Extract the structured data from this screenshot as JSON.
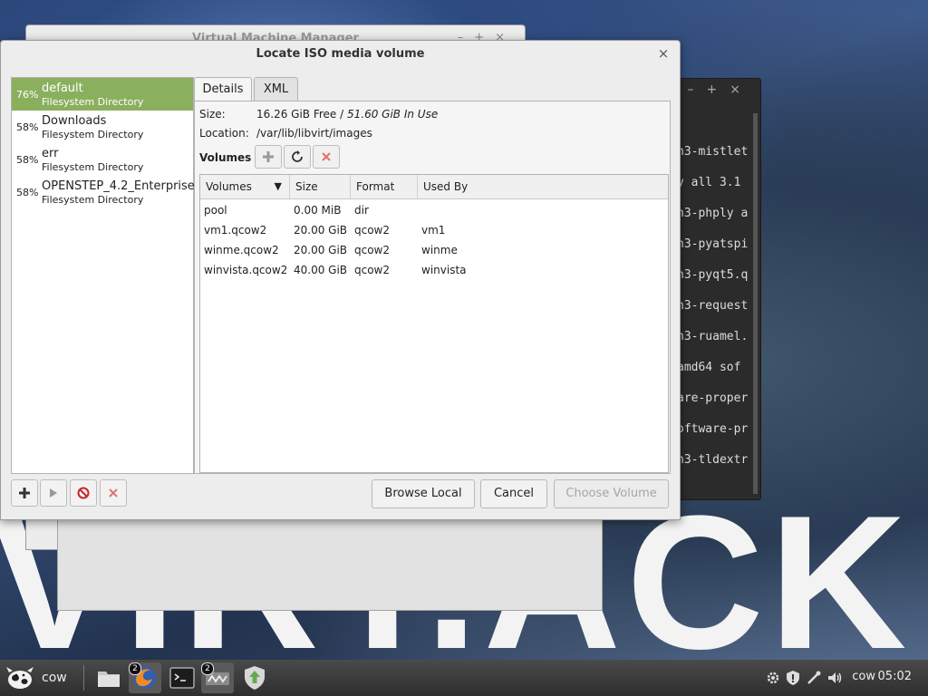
{
  "desktop": {
    "wallpaper_text": "VIRT.ACK"
  },
  "background_window": {
    "title": "Virtual Machine Manager",
    "controls": [
      "–",
      "+",
      "×"
    ]
  },
  "terminal": {
    "controls": [
      "–",
      "+",
      "×"
    ],
    "lines": [
      "n3-mistlet",
      "y all 3.1",
      "n3-phply a",
      "n3-pyatspi",
      "n3-pyqt5.q",
      "n3-request",
      "n3-ruamel.",
      "amd64 sof",
      "are-proper",
      "oftware-pr",
      "n3-tldextr"
    ]
  },
  "dialog": {
    "title": "Locate ISO media volume",
    "close_label": "×",
    "pools": [
      {
        "percent": "76%",
        "name": "default",
        "type": "Filesystem Directory",
        "selected": true
      },
      {
        "percent": "58%",
        "name": "Downloads",
        "type": "Filesystem Directory",
        "selected": false
      },
      {
        "percent": "58%",
        "name": "err",
        "type": "Filesystem Directory",
        "selected": false
      },
      {
        "percent": "58%",
        "name": "OPENSTEP_4.2_Enterprise",
        "type": "Filesystem Directory",
        "selected": false
      }
    ],
    "tabs": [
      {
        "label": "Details",
        "active": true
      },
      {
        "label": "XML",
        "active": false
      }
    ],
    "details": {
      "size_label": "Size:",
      "size_free": "16.26 GiB Free",
      "size_separator": " / ",
      "size_in_use": "51.60 GiB In Use",
      "location_label": "Location:",
      "location_value": "/var/lib/libvirt/images",
      "volumes_label": "Volumes"
    },
    "volume_table": {
      "columns": [
        "Volumes",
        "Size",
        "Format",
        "Used By"
      ],
      "sort_indicator": "▼",
      "rows": [
        {
          "name": "pool",
          "size": "0.00 MiB",
          "format": "dir",
          "used_by": ""
        },
        {
          "name": "vm1.qcow2",
          "size": "20.00 GiB",
          "format": "qcow2",
          "used_by": "vm1"
        },
        {
          "name": "winme.qcow2",
          "size": "20.00 GiB",
          "format": "qcow2",
          "used_by": "winme"
        },
        {
          "name": "winvista.qcow2",
          "size": "40.00 GiB",
          "format": "qcow2",
          "used_by": "winvista"
        }
      ]
    },
    "buttons": {
      "browse_local": "Browse Local",
      "cancel": "Cancel",
      "choose_volume": "Choose Volume"
    }
  },
  "taskbar": {
    "menu_label": "cow",
    "firefox_badge": "2",
    "virt_badge": "2",
    "user": "cow",
    "clock": "05:02"
  },
  "colors": {
    "selection": "#8ab05e",
    "delete_red": "#c0392b"
  }
}
